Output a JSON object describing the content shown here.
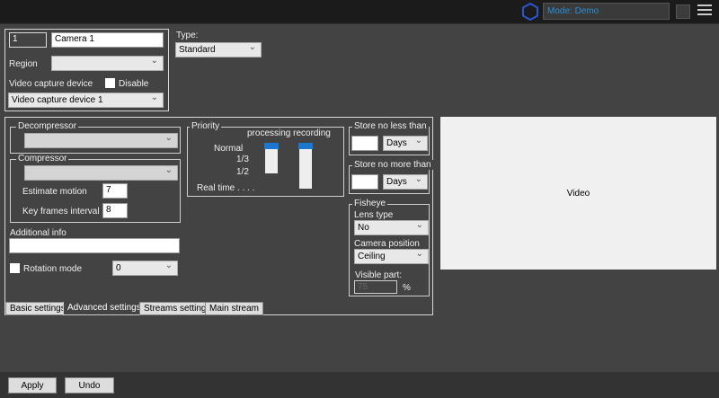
{
  "topbar": {
    "mode": "Mode: Demo",
    "icons": [
      "hexagon-logo-icon",
      "layout-grid-icon",
      "menu-icon"
    ]
  },
  "camera": {
    "id": "1",
    "name": "Camera 1",
    "region_label": "Region",
    "region_value": "",
    "capture_label": "Video capture device",
    "disable_label": "Disable",
    "capture_value": "Video capture device 1"
  },
  "type": {
    "label": "Type:",
    "value": "Standard"
  },
  "decompressor": {
    "label": "Decompressor",
    "value": ""
  },
  "compressor": {
    "label": "Compressor",
    "value": "",
    "estimate_label": "Estimate motion",
    "estimate_value": "7",
    "keyframes_label": "Key frames interval",
    "keyframes_value": "8"
  },
  "additional": {
    "label": "Additional info",
    "value": ""
  },
  "rotation": {
    "label": "Rotation mode",
    "value": "0"
  },
  "priority": {
    "label": "Priority",
    "header": "processing recording",
    "levels": [
      "Normal",
      "1/3",
      "1/2",
      "Real time . . . ."
    ]
  },
  "store_min": {
    "label": "Store no less than",
    "value": "",
    "unit": "Days"
  },
  "store_max": {
    "label": "Store no more than",
    "value": "",
    "unit": "Days"
  },
  "fisheye": {
    "label": "Fisheye",
    "lens_label": "Lens type",
    "lens_value": "No",
    "position_label": "Camera position",
    "position_value": "Ceiling",
    "visible_label": "Visible part:",
    "visible_value": "75",
    "visible_unit": "%"
  },
  "video": {
    "label": "Video"
  },
  "tabs": [
    "Basic settings",
    "Advanced settings",
    "Streams settings",
    "Main stream"
  ],
  "buttons": {
    "apply": "Apply",
    "undo": "Undo"
  }
}
